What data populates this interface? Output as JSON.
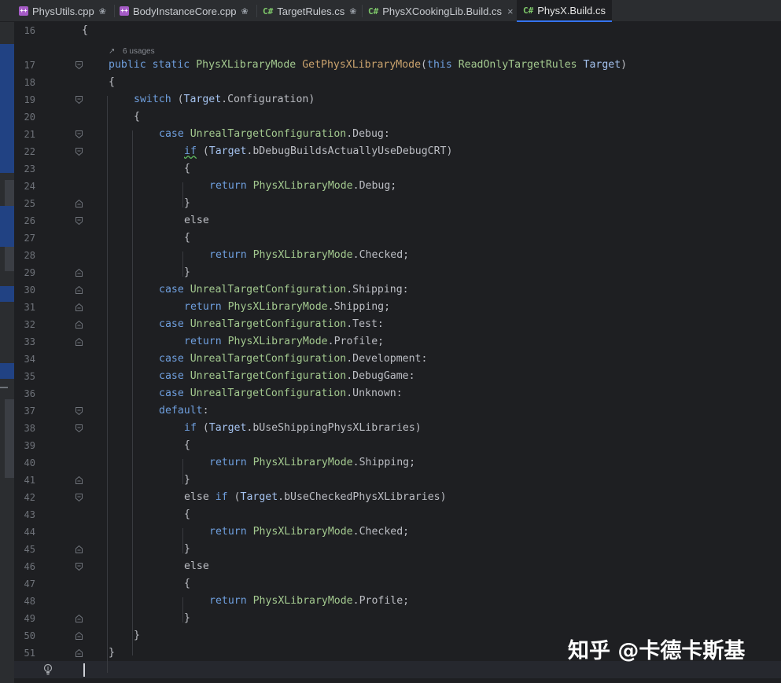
{
  "tabs": [
    {
      "label": "PhysUtils.cpp",
      "type": "cpp",
      "pinned": true,
      "active": false
    },
    {
      "label": "BodyInstanceCore.cpp",
      "type": "cpp",
      "pinned": true,
      "active": false
    },
    {
      "label": "TargetRules.cs",
      "type": "C#",
      "pinned": true,
      "active": false
    },
    {
      "label": "PhysXCookingLib.Build.cs",
      "type": "C#",
      "pinned": false,
      "close": "×",
      "active": false
    },
    {
      "label": "PhysX.Build.cs",
      "type": "C#",
      "pinned": false,
      "active": true
    }
  ],
  "editor": {
    "usages_hint": "6 usages",
    "line_numbers": [
      "16",
      "17",
      "18",
      "19",
      "20",
      "21",
      "22",
      "23",
      "24",
      "25",
      "26",
      "27",
      "28",
      "29",
      "30",
      "31",
      "32",
      "33",
      "34",
      "35",
      "36",
      "37",
      "38",
      "39",
      "40",
      "41",
      "42",
      "43",
      "44",
      "45",
      "46",
      "47",
      "48",
      "49",
      "50",
      "51",
      "52"
    ],
    "code": {
      "l16": "{",
      "l17_public": "public",
      "l17_static": "static",
      "l17_type": "PhysXLibraryMode",
      "l17_fn": "GetPhysXLibraryMode",
      "l17_open": "(",
      "l17_this": "this",
      "l17_ptype": "ReadOnlyTargetRules",
      "l17_param": "Target",
      "l17_close": ")",
      "l18": "{",
      "l19_switch": "switch",
      "l19_open": " (",
      "l19_target": "Target",
      "l19_rest": ".Configuration)",
      "l20": "{",
      "l21_case": "case",
      "l21_type": "UnrealTargetConfiguration",
      "l21_rest": ".Debug:",
      "l22_if": "if",
      "l22_open": " (",
      "l22_target": "Target",
      "l22_rest": ".bDebugBuildsActuallyUseDebugCRT)",
      "l23": "{",
      "l24_return": "return",
      "l24_type": "PhysXLibraryMode",
      "l24_rest": ".Debug;",
      "l25": "}",
      "l26": "else",
      "l27": "{",
      "l28_return": "return",
      "l28_type": "PhysXLibraryMode",
      "l28_rest": ".Checked;",
      "l29": "}",
      "l30_case": "case",
      "l30_type": "UnrealTargetConfiguration",
      "l30_rest": ".Shipping:",
      "l31_return": "return",
      "l31_type": "PhysXLibraryMode",
      "l31_rest": ".Shipping;",
      "l32_case": "case",
      "l32_type": "UnrealTargetConfiguration",
      "l32_rest": ".Test:",
      "l33_return": "return",
      "l33_type": "PhysXLibraryMode",
      "l33_rest": ".Profile;",
      "l34_case": "case",
      "l34_type": "UnrealTargetConfiguration",
      "l34_rest": ".Development:",
      "l35_case": "case",
      "l35_type": "UnrealTargetConfiguration",
      "l35_rest": ".DebugGame:",
      "l36_case": "case",
      "l36_type": "UnrealTargetConfiguration",
      "l36_rest": ".Unknown:",
      "l37_default": "default",
      "l37_rest": ":",
      "l38_if": "if",
      "l38_open": " (",
      "l38_target": "Target",
      "l38_rest": ".bUseShippingPhysXLibraries)",
      "l39": "{",
      "l40_return": "return",
      "l40_type": "PhysXLibraryMode",
      "l40_rest": ".Shipping;",
      "l41": "}",
      "l42_else": "else",
      "l42_if": "if",
      "l42_open": " (",
      "l42_target": "Target",
      "l42_rest": ".bUseCheckedPhysXLibraries)",
      "l43": "{",
      "l44_return": "return",
      "l44_type": "PhysXLibraryMode",
      "l44_rest": ".Checked;",
      "l45": "}",
      "l46": "else",
      "l47": "{",
      "l48_return": "return",
      "l48_type": "PhysXLibraryMode",
      "l48_rest": ".Profile;",
      "l49": "}",
      "l50": "}",
      "l51": "}"
    }
  },
  "watermark": "知乎 @卡德卡斯基",
  "icons": {
    "tab_cpp": "cpp-file-icon",
    "tab_cs": "csharp-file-icon",
    "pin": "pin-icon",
    "close": "close-icon",
    "fold": "fold-marker-icon",
    "bulb": "intention-bulb-icon",
    "usages": "usages-link-icon"
  },
  "colors": {
    "background": "#1e1f22",
    "keyword": "#cf8e6d",
    "type": "#a3c98f",
    "function": "#c9a26d",
    "accent": "#3574f0"
  }
}
